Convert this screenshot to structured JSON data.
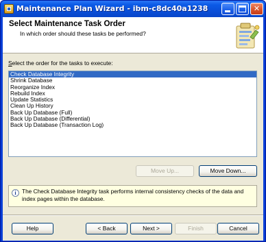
{
  "window": {
    "title": "Maintenance Plan Wizard - ibm-c8dc40a1238",
    "controls": {
      "minimize": "minimize",
      "maximize": "maximize",
      "close": "✕"
    }
  },
  "header": {
    "title": "Select Maintenance Task Order",
    "subtitle": "In which order should these tasks be performed?"
  },
  "main": {
    "prompt": "Select the order for the tasks to execute:",
    "tasks": [
      "Check Database Integrity",
      "Shrink Database",
      "Reorganize Index",
      "Rebuild Index",
      "Update Statistics",
      "Clean Up History",
      "Back Up Database (Full)",
      "Back Up Database (Differential)",
      "Back Up Database (Transaction Log)"
    ],
    "selected_index": 0,
    "move_up_label": "Move Up...",
    "move_down_label": "Move Down...",
    "info_text": "The Check Database Integrity task performs internal consistency checks of the data and index pages within the database."
  },
  "footer": {
    "help_label": "Help",
    "back_label": "< Back",
    "next_label": "Next >",
    "finish_label": "Finish",
    "cancel_label": "Cancel"
  },
  "icons": {
    "title_icon": "wizard-app-icon",
    "header_icon": "wizard-clipboard-icon",
    "info_icon": "info-icon"
  },
  "colors": {
    "titlebar": "#0a4fd9",
    "selection": "#316ac5",
    "info_background": "#ffffe1",
    "dialog_background": "#ece9d8"
  }
}
